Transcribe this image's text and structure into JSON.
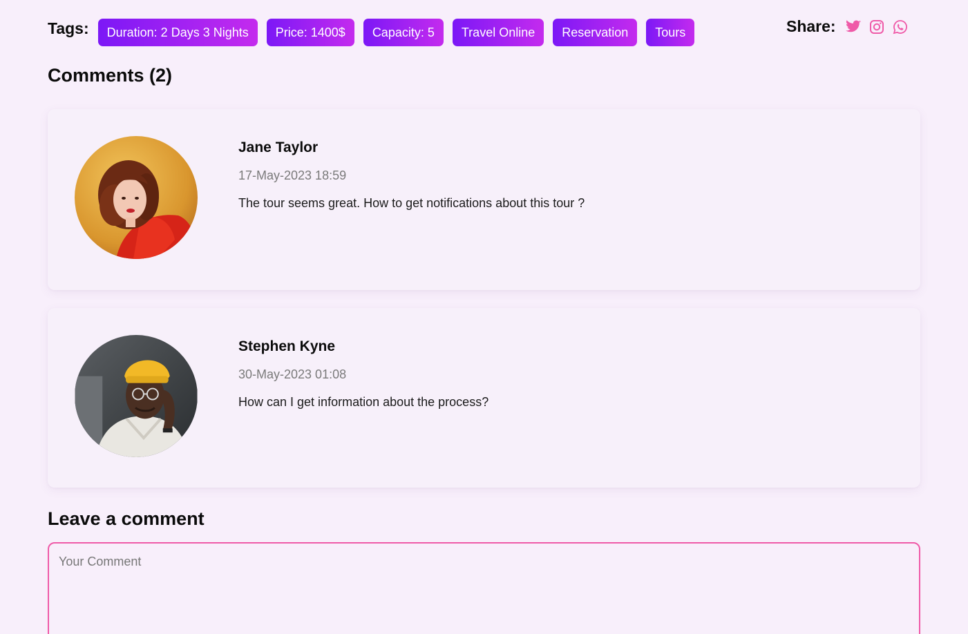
{
  "tags": {
    "label": "Tags:",
    "items": [
      "Duration: 2 Days 3 Nights",
      "Price: 1400$",
      "Capacity: 5",
      "Travel Online",
      "Reservation",
      "Tours"
    ]
  },
  "share": {
    "label": "Share:",
    "icons": [
      "twitter-icon",
      "instagram-icon",
      "whatsapp-icon"
    ],
    "icon_color": "#ef5aa8"
  },
  "comments": {
    "title": "Comments (2)",
    "items": [
      {
        "name": "Jane Taylor",
        "date": "17-May-2023 18:59",
        "text": "The tour seems great. How to get notifications about this tour ?",
        "avatar": "avatar-photo-woman"
      },
      {
        "name": "Stephen Kyne",
        "date": "30-May-2023 01:08",
        "text": "How can I get information about the process?",
        "avatar": "avatar-photo-man"
      }
    ]
  },
  "leave_comment": {
    "title": "Leave a comment",
    "placeholder": "Your Comment",
    "value": ""
  },
  "colors": {
    "background": "#f8effb",
    "tag_gradient_start": "#7c18f6",
    "tag_gradient_end": "#c42bee",
    "accent": "#ef5aa8"
  }
}
